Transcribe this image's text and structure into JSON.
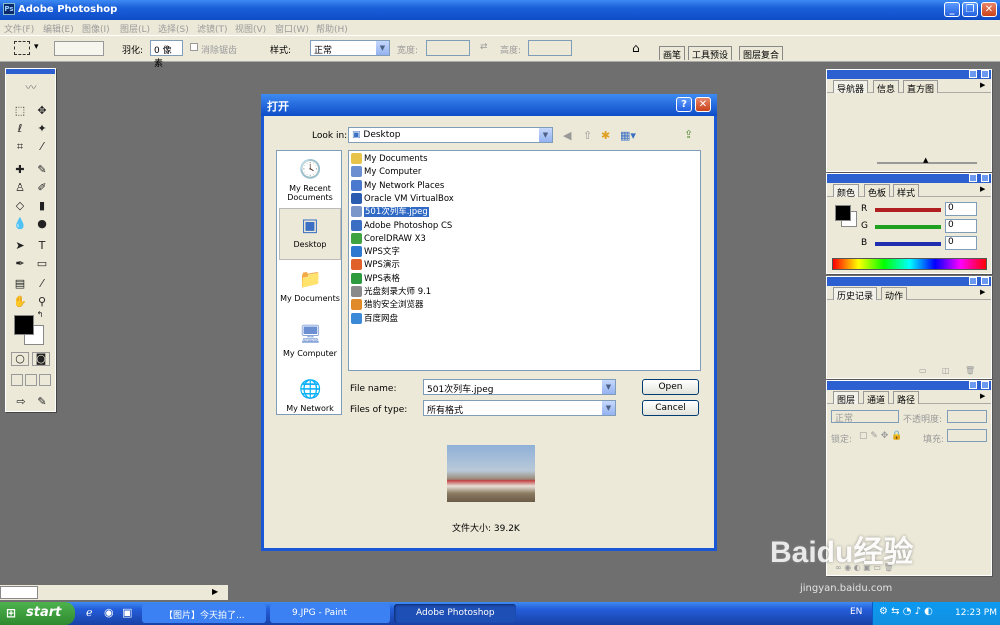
{
  "app": {
    "title": "Adobe Photoshop"
  },
  "menu": [
    "文件(F)",
    "编辑(E)",
    "图像(I)",
    "图层(L)",
    "选择(S)",
    "滤镜(T)",
    "视图(V)",
    "窗口(W)",
    "帮助(H)"
  ],
  "options": {
    "feather_label": "羽化:",
    "feather_value": "0 像素",
    "antialias_label": "消除锯齿",
    "style_label": "样式:",
    "style_value": "正常",
    "width_label": "宽度:",
    "height_label": "高度:",
    "workspace_tabs": [
      "画笔",
      "工具预设",
      "图层复合"
    ]
  },
  "panels": {
    "navigator_tabs": [
      "导航器",
      "信息",
      "直方图"
    ],
    "color_tabs": [
      "颜色",
      "色板",
      "样式"
    ],
    "color_rgb": [
      {
        "label": "R",
        "value": "0"
      },
      {
        "label": "G",
        "value": "0"
      },
      {
        "label": "B",
        "value": "0"
      }
    ],
    "history_tabs": [
      "历史记录",
      "动作"
    ],
    "layers_tabs": [
      "图层",
      "通道",
      "路径"
    ],
    "layers_mode": "正常",
    "layers_opacity_label": "不透明度:",
    "layers_lock_label": "锁定:",
    "layers_fill_label": "填充:"
  },
  "dialog": {
    "title": "打开",
    "look_in_label": "Look in:",
    "look_in_value": "Desktop",
    "places": [
      {
        "label": "My Recent Documents",
        "icon": "recent-documents-icon"
      },
      {
        "label": "Desktop",
        "icon": "desktop-icon"
      },
      {
        "label": "My Documents",
        "icon": "my-documents-icon"
      },
      {
        "label": "My Computer",
        "icon": "my-computer-icon"
      },
      {
        "label": "My Network",
        "icon": "my-network-icon"
      }
    ],
    "files": [
      {
        "name": "My Documents",
        "color": "#e8c34a"
      },
      {
        "name": "My Computer",
        "color": "#6b8fd0"
      },
      {
        "name": "My Network Places",
        "color": "#4a7ad0"
      },
      {
        "name": "Oracle VM VirtualBox",
        "color": "#2a5db0"
      },
      {
        "name": "501次列车.jpeg",
        "color": "#7b96c9"
      },
      {
        "name": "Adobe Photoshop CS",
        "color": "#3a6fc4"
      },
      {
        "name": "CorelDRAW X3",
        "color": "#3fa33f"
      },
      {
        "name": "WPS文字",
        "color": "#2f78d1"
      },
      {
        "name": "WPS演示",
        "color": "#e0622a"
      },
      {
        "name": "WPS表格",
        "color": "#2e9a3e"
      },
      {
        "name": "光盘刻录大师 9.1",
        "color": "#8a8a8a"
      },
      {
        "name": "猎豹安全浏览器",
        "color": "#e08a2a"
      },
      {
        "name": "百度网盘",
        "color": "#3a8ad8"
      }
    ],
    "selected_index": 4,
    "file_name_label": "File name:",
    "file_name_value": "501次列车.jpeg",
    "file_type_label": "Files of type:",
    "file_type_value": "所有格式",
    "open_label": "Open",
    "cancel_label": "Cancel",
    "file_size": "文件大小: 39.2K"
  },
  "taskbar": {
    "start_label": "start",
    "tasks": [
      "【图片】今天拍了...",
      "9.JPG - Paint",
      "Adobe Photoshop"
    ],
    "language": "EN",
    "clock": "12:23 PM"
  },
  "watermark": {
    "text": "Baidu经验",
    "url": "jingyan.baidu.com"
  }
}
